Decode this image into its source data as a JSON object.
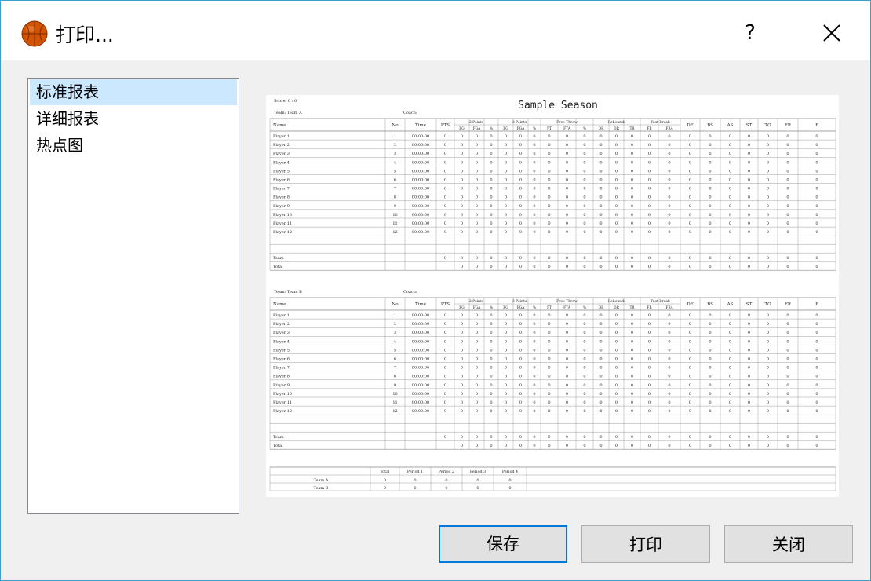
{
  "window": {
    "title": "打印...",
    "app_icon": "basketball-icon",
    "help_label": "?",
    "close_icon": "close-icon"
  },
  "report_types": [
    {
      "label": "标准报表",
      "selected": true
    },
    {
      "label": "详细报表",
      "selected": false
    },
    {
      "label": "热点图",
      "selected": false
    }
  ],
  "preview": {
    "score": "Score: 0 : 0",
    "title": "Sample Season",
    "coach_label": "Coach:",
    "teams": [
      {
        "team_label": "Team: Team A"
      },
      {
        "team_label": "Team: Team B"
      }
    ],
    "columns": [
      "Name",
      "No",
      "Time",
      "PTS",
      "FG",
      "FGA",
      "%",
      "FG",
      "FGA",
      "%",
      "FT",
      "FTA",
      "%",
      "OR",
      "DR",
      "TR",
      "FB",
      "FBA",
      "DE",
      "BS",
      "AS",
      "ST",
      "TO",
      "FR",
      "F"
    ],
    "groups": [
      {
        "label": "2 Points",
        "span": [
          4,
          6
        ]
      },
      {
        "label": "3 Points",
        "span": [
          7,
          9
        ]
      },
      {
        "label": "Free Throw",
        "span": [
          10,
          12
        ]
      },
      {
        "label": "Rebounds",
        "span": [
          13,
          15
        ]
      },
      {
        "label": "Fast Break",
        "span": [
          16,
          17
        ]
      }
    ],
    "players": [
      {
        "name": "Player 1",
        "no": "1"
      },
      {
        "name": "Player 2",
        "no": "2"
      },
      {
        "name": "Player 3",
        "no": "3"
      },
      {
        "name": "Player 4",
        "no": "4"
      },
      {
        "name": "Player 5",
        "no": "5"
      },
      {
        "name": "Player 6",
        "no": "6"
      },
      {
        "name": "Player 7",
        "no": "7"
      },
      {
        "name": "Player 8",
        "no": "8"
      },
      {
        "name": "Player 9",
        "no": "9"
      },
      {
        "name": "Player 10",
        "no": "10"
      },
      {
        "name": "Player 11",
        "no": "11"
      },
      {
        "name": "Player 12",
        "no": "12"
      }
    ],
    "time_value": "00:00:00",
    "zero": "0",
    "team_row_label": "Team",
    "total_row_label": "Total",
    "period_table": {
      "headers": [
        "Total",
        "Period 1",
        "Period 2",
        "Period 3",
        "Period 4"
      ],
      "rows": [
        {
          "team": "Team A",
          "values": [
            "0",
            "0",
            "0",
            "0",
            "0"
          ]
        },
        {
          "team": "Team B",
          "values": [
            "0",
            "0",
            "0",
            "0",
            "0"
          ]
        }
      ]
    }
  },
  "buttons": {
    "save": "保存",
    "print": "打印",
    "close": "关闭"
  }
}
